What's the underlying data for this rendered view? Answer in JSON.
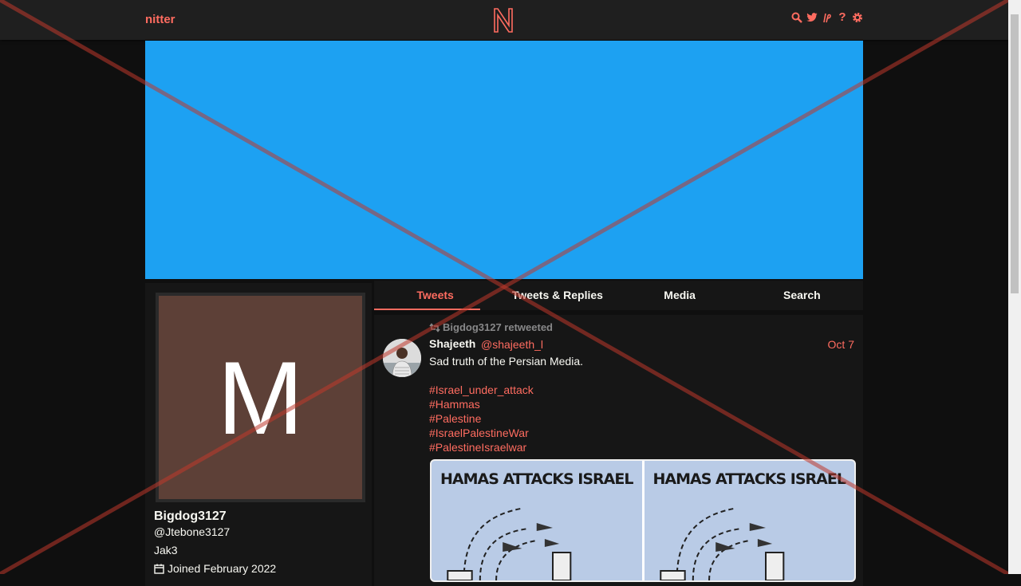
{
  "nav": {
    "brand": "nitter",
    "icons": [
      "search-icon",
      "twitter-bird-icon",
      "rss-icon",
      "help-icon",
      "gear-icon"
    ]
  },
  "profile": {
    "avatar_letter": "M",
    "fullname": "Bigdog3127",
    "username": "@Jtebone3127",
    "bio": "Jak3",
    "joined": "Joined February 2022"
  },
  "tabs": [
    {
      "label": "Tweets",
      "active": true
    },
    {
      "label": "Tweets & Replies",
      "active": false
    },
    {
      "label": "Media",
      "active": false
    },
    {
      "label": "Search",
      "active": false
    }
  ],
  "tweet": {
    "retweet_label": "Bigdog3127 retweeted",
    "fullname": "Shajeeth",
    "username": "@shajeeth_l",
    "date": "Oct 7",
    "text": "Sad truth of the Persian Media.",
    "hashtags": [
      "#Israel_under_attack",
      "#Hammas",
      "#Palestine",
      "#IsraelPalestineWar",
      "#PalestineIsraelwar"
    ],
    "media_panels": [
      {
        "caption": "HAMAS ATTACKS ISRAEL"
      },
      {
        "caption": "HAMAS ATTACKS ISRAEL"
      }
    ]
  },
  "colors": {
    "accent": "#ff6c60",
    "banner": "#1da1f2",
    "avatar_bg": "#5d4037",
    "background": "#0f0f0f",
    "panel": "#161616"
  }
}
